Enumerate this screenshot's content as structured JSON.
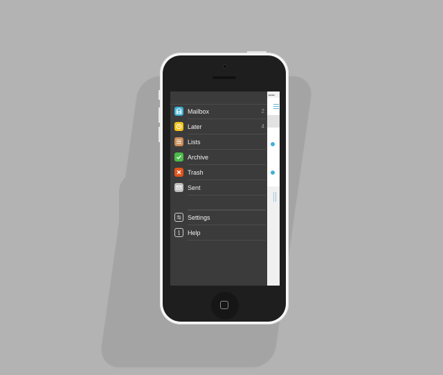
{
  "menu": {
    "items": [
      {
        "label": "Mailbox",
        "count": "2",
        "icon": "mailbox-icon",
        "color": "#3fb0d4"
      },
      {
        "label": "Later",
        "count": "4",
        "icon": "clock-icon",
        "color": "#f2c51d"
      },
      {
        "label": "Lists",
        "count": "",
        "icon": "list-icon",
        "color": "#c98c56"
      },
      {
        "label": "Archive",
        "count": "",
        "icon": "checkmark-icon",
        "color": "#4cbb49"
      },
      {
        "label": "Trash",
        "count": "",
        "icon": "x-icon",
        "color": "#e0541c"
      },
      {
        "label": "Sent",
        "count": "",
        "icon": "envelope-icon",
        "color": "#bdbdbd"
      }
    ],
    "secondary": [
      {
        "label": "Settings",
        "icon": "sliders-icon"
      },
      {
        "label": "Help",
        "icon": "info-icon"
      }
    ]
  },
  "status": {
    "signal": "••••"
  }
}
